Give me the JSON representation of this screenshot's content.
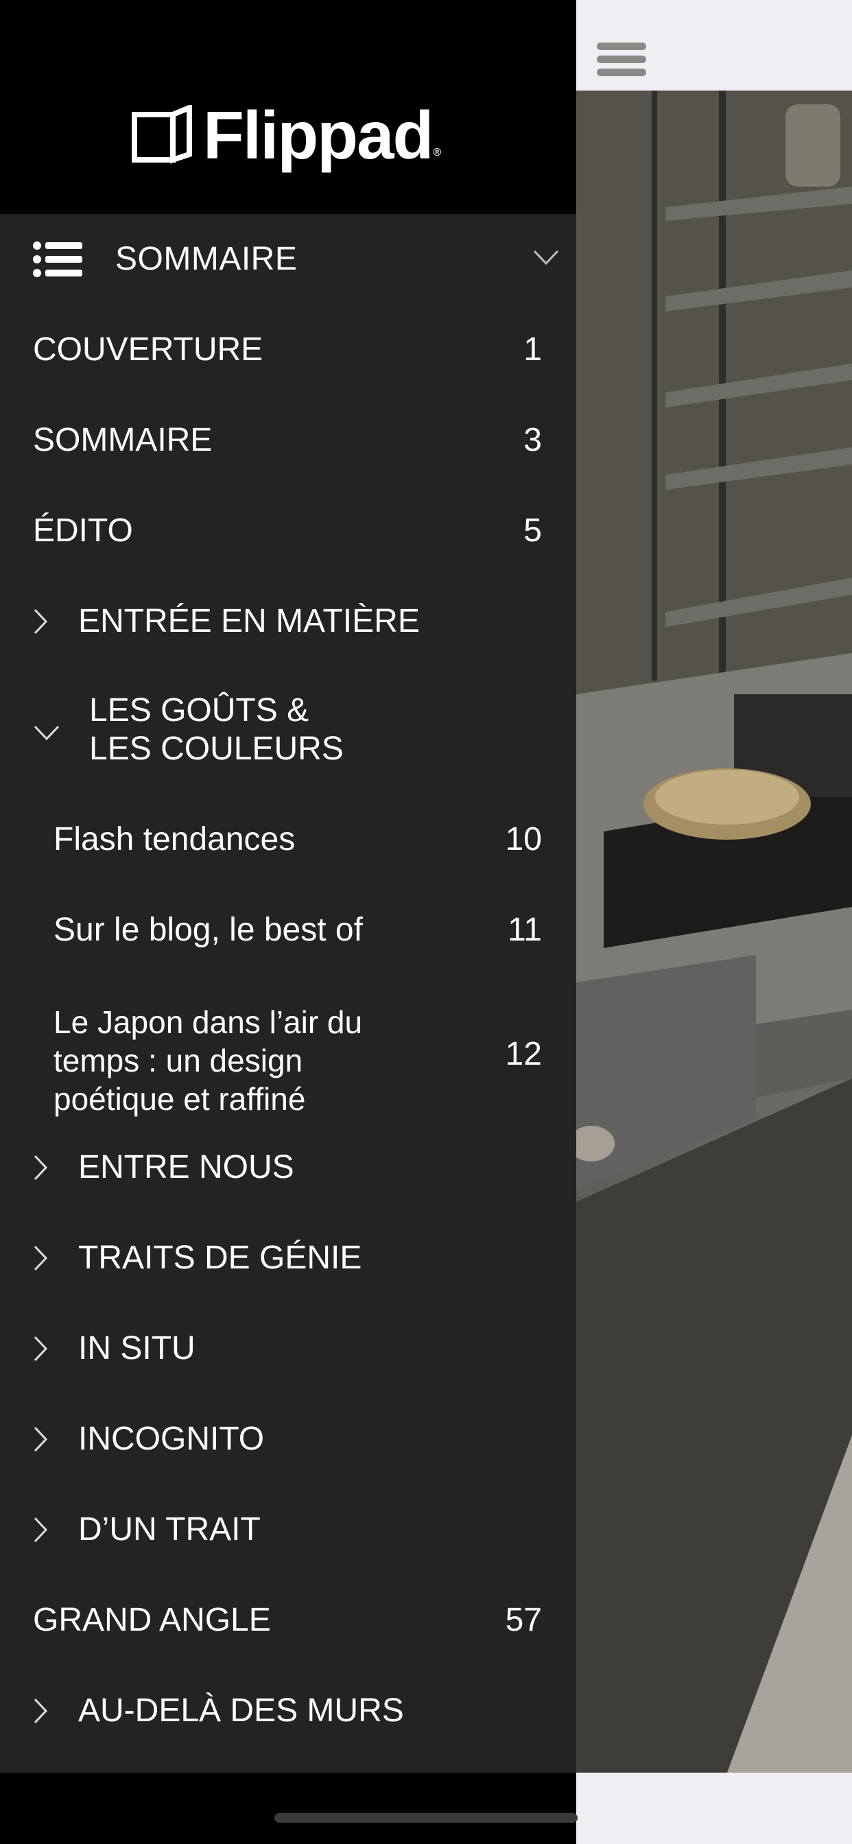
{
  "brand": {
    "name": "Flippad",
    "mark": "®"
  },
  "toc": {
    "title": "SOMMAIRE",
    "items": [
      {
        "label": "COUVERTURE",
        "page": "1"
      },
      {
        "label": "SOMMAIRE",
        "page": "3"
      },
      {
        "label": "ÉDITO",
        "page": "5"
      },
      {
        "label": "ENTRÉE EN MATIÈRE"
      },
      {
        "label_line1": "LES GOÛTS &",
        "label_line2": "LES COULEURS"
      },
      {
        "label": "Flash tendances",
        "page": "10"
      },
      {
        "label": "Sur le blog, le best of",
        "page": "11"
      },
      {
        "label_line1": "Le Japon dans l’air du",
        "label_line2": "temps : un design",
        "label_line3": "poétique et raffiné",
        "page": "12"
      },
      {
        "label": "ENTRE NOUS"
      },
      {
        "label": "TRAITS DE GÉNIE"
      },
      {
        "label": "IN SITU"
      },
      {
        "label": "INCOGNITO"
      },
      {
        "label": "D’UN TRAIT"
      },
      {
        "label": "GRAND ANGLE",
        "page": "57"
      },
      {
        "label": "AU-DELÀ DES MURS"
      }
    ]
  },
  "icons": {
    "menu": "hamburger-icon",
    "toc": "list-icon",
    "collapse": "chevron-down-icon",
    "expand": "chevron-right-icon"
  },
  "colors": {
    "drawer": "#232323",
    "header": "#000000",
    "text": "#ffffff"
  }
}
